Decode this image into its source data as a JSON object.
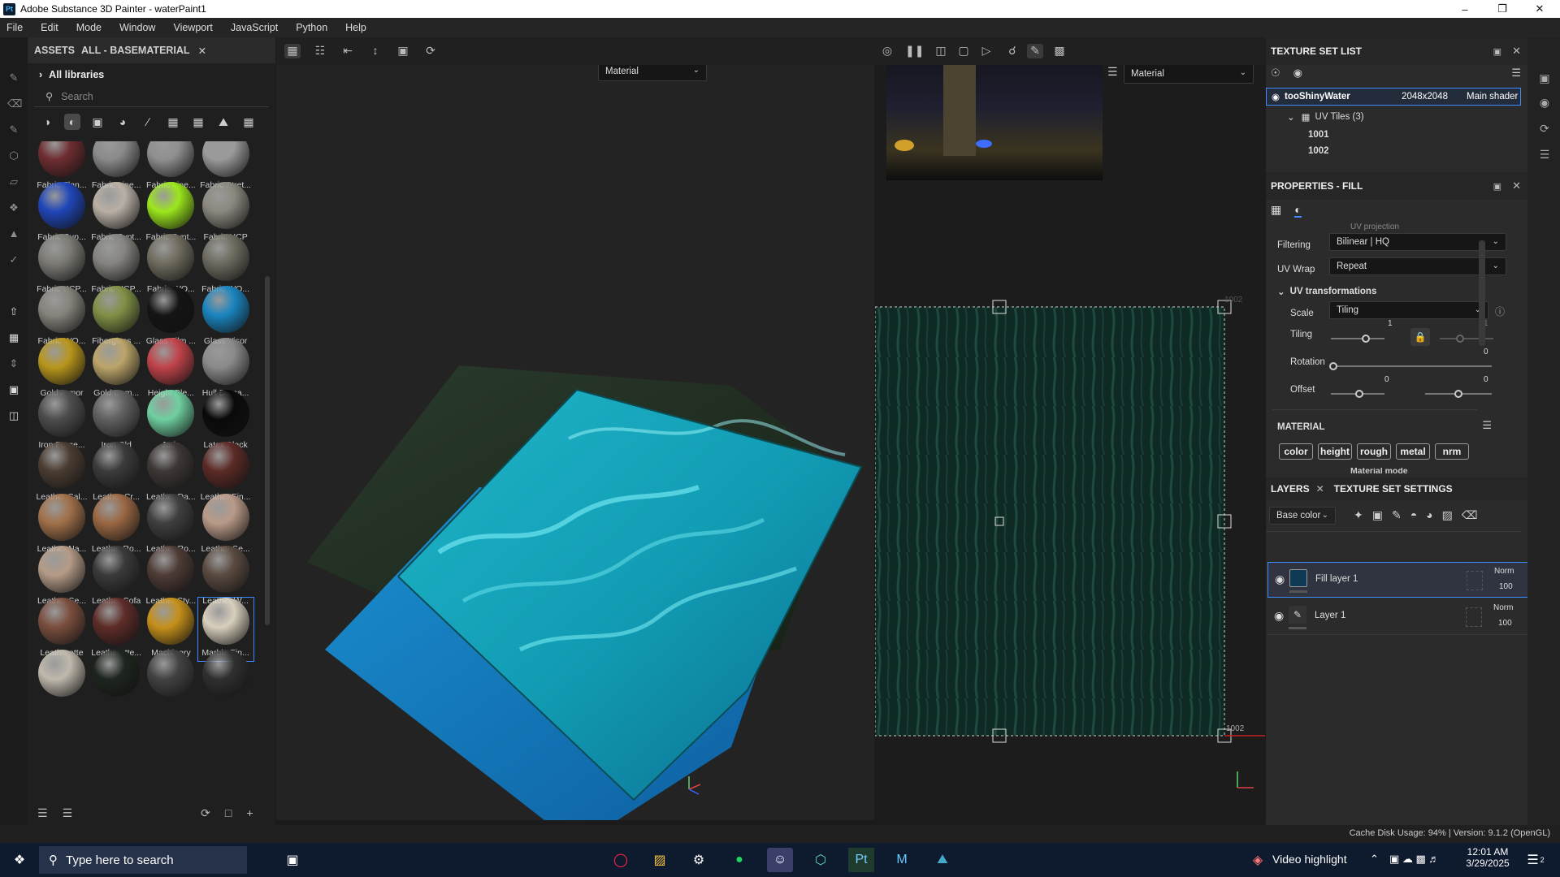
{
  "window": {
    "title": "Adobe Substance 3D Painter - waterPaint1",
    "app_icon": "Pt"
  },
  "menu": [
    "File",
    "Edit",
    "Mode",
    "Window",
    "Viewport",
    "JavaScript",
    "Python",
    "Help"
  ],
  "assets": {
    "tab_label": "ASSETS",
    "filter_label": "ALL - BASEMATERIAL",
    "libraries": "All libraries",
    "search_placeholder": "Search",
    "items": [
      {
        "label": "Fabric Flan...",
        "color": "#6e2d30"
      },
      {
        "label": "Fabric Line...",
        "color": "#8a8a8a"
      },
      {
        "label": "Fabric Line...",
        "color": "#8f8f8f"
      },
      {
        "label": "Fabric Stret...",
        "color": "#9a9a9a"
      },
      {
        "label": "Fabric Sup...",
        "color": "#1f46b8"
      },
      {
        "label": "Fabric Synt...",
        "color": "#b9b0a5"
      },
      {
        "label": "Fabric Synt...",
        "color": "#9be61c"
      },
      {
        "label": "Fabric UCP",
        "color": "#8a887e"
      },
      {
        "label": "Fabric UCP...",
        "color": "#7c7b75"
      },
      {
        "label": "Fabric UCP...",
        "color": "#858480"
      },
      {
        "label": "Fabric WO...",
        "color": "#6f6c5e"
      },
      {
        "label": "Fabric WO...",
        "color": "#6d6b5f"
      },
      {
        "label": "Fabric WO...",
        "color": "#86837c"
      },
      {
        "label": "Fiberglass ...",
        "color": "#7f9045"
      },
      {
        "label": "Glass Film ...",
        "color": "#141414"
      },
      {
        "label": "Glass Visor",
        "color": "#1a84bf"
      },
      {
        "label": "Gold Armor",
        "color": "#b8961c"
      },
      {
        "label": "Gold Dam...",
        "color": "#bca56a"
      },
      {
        "label": "Height Ble...",
        "color": "#c0434a"
      },
      {
        "label": "Hull Dama...",
        "color": "#8a8a8a"
      },
      {
        "label": "Iron Forge...",
        "color": "#4d4d4d"
      },
      {
        "label": "Iron Old",
        "color": "#606060"
      },
      {
        "label": "Jade",
        "color": "#6fcfa0"
      },
      {
        "label": "Latex Black",
        "color": "#0a0a0a"
      },
      {
        "label": "Leather Cal...",
        "color": "#4a3c31"
      },
      {
        "label": "Leather Cr...",
        "color": "#3b3b3b"
      },
      {
        "label": "Leather Da...",
        "color": "#3d3735"
      },
      {
        "label": "Leather Fin...",
        "color": "#5b2a26"
      },
      {
        "label": "Leather Na...",
        "color": "#a17049"
      },
      {
        "label": "Leather Ro...",
        "color": "#9a6743"
      },
      {
        "label": "Leather Ro...",
        "color": "#3f3f3f"
      },
      {
        "label": "Leather Se...",
        "color": "#b99a88"
      },
      {
        "label": "Leather Se...",
        "color": "#b49b86"
      },
      {
        "label": "Leather Sofa",
        "color": "#3a3a3a"
      },
      {
        "label": "Leather Sty...",
        "color": "#4e3b35"
      },
      {
        "label": "Leather W...",
        "color": "#5a4a40"
      },
      {
        "label": "Leatherette",
        "color": "#7a4e3e"
      },
      {
        "label": "Leatherette...",
        "color": "#5e2c28"
      },
      {
        "label": "Machinery",
        "color": "#c5901a"
      },
      {
        "label": "Marble Fin...",
        "color": "#d8cfbd"
      },
      {
        "label": "",
        "color": "#bfb8ac"
      },
      {
        "label": "",
        "color": "#1e251e"
      },
      {
        "label": "",
        "color": "#424242"
      },
      {
        "label": "",
        "color": "#2f2f2f"
      }
    ],
    "selected_index": 39
  },
  "viewport3d": {
    "mode_dropdown": "Material"
  },
  "viewport2d": {
    "mode_dropdown": "Material",
    "tile_label_top": "1002",
    "tile_label_bottom": "1002"
  },
  "texture_set_list": {
    "title": "TEXTURE SET LIST",
    "set_name": "tooShinyWater",
    "resolution": "2048x2048",
    "shader": "Main shader",
    "uv_tiles_label": "UV Tiles (3)",
    "tiles": [
      "1001",
      "1002"
    ]
  },
  "properties": {
    "title": "PROPERTIES - FILL",
    "projection_partial": "UV projection",
    "filtering_label": "Filtering",
    "filtering_value": "Bilinear | HQ",
    "uvwrap_label": "UV Wrap",
    "uvwrap_value": "Repeat",
    "uv_transform_label": "UV transformations",
    "scale_label": "Scale",
    "scale_value": "Tiling",
    "tiling_label": "Tiling",
    "tiling_value": "1",
    "tiling_value2": "1",
    "rotation_label": "Rotation",
    "rotation_value": "0",
    "offset_label": "Offset",
    "offset_value1": "0",
    "offset_value2": "0",
    "material_label": "MATERIAL",
    "channels": [
      "color",
      "height",
      "rough",
      "metal",
      "nrm"
    ],
    "material_mode_partial": "Material mode"
  },
  "layers": {
    "tab_label": "LAYERS",
    "settings_tab": "TEXTURE SET SETTINGS",
    "channel_dropdown": "Base color",
    "items": [
      {
        "name": "Fill layer 1",
        "blend": "Norm",
        "opacity": "100"
      },
      {
        "name": "Layer 1",
        "blend": "Norm",
        "opacity": "100"
      }
    ]
  },
  "statusbar": {
    "text": "Cache Disk Usage:   94% | Version: 9.1.2 (OpenGL)"
  },
  "taskbar": {
    "search_placeholder": "Type here to search",
    "video_highlight": "Video highlight",
    "time": "12:01 AM",
    "date": "3/29/2025",
    "notification_count": "2"
  }
}
